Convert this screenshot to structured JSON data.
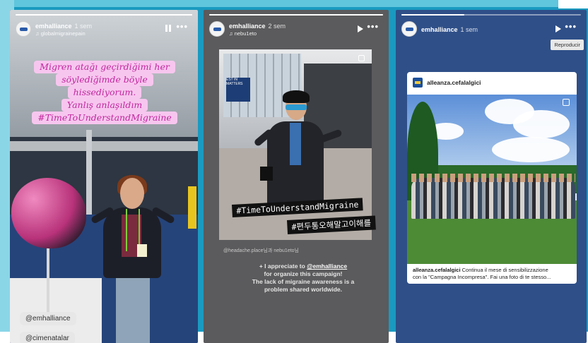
{
  "stories": [
    {
      "username": "emhalliance",
      "time": "1 sem",
      "subline": "globalmigrainepain",
      "progress": 1.0,
      "control": "pause",
      "more_label": "•••",
      "caption_lines": [
        "Migren atağı geçirdiğimi her",
        "söylediğimde böyle",
        "hissediyorum.",
        "Yanlış anlaşıldım",
        "#TimeToUnderstandMigraine"
      ],
      "mention_tags": [
        "@emhalliance",
        "@cimenatalar"
      ]
    },
    {
      "username": "emhalliance",
      "time": "2 sem",
      "subline": "nebu1eto",
      "progress": 1.0,
      "control": "play",
      "more_label": "•••",
      "sign_text": "EST IN MATTERS",
      "hashtags": [
        "#TimeToUnderstandMigraine",
        "#편두통오해말고이해를"
      ],
      "mention_line": "@headache.place님과 nebu1eto님",
      "post_text": {
        "line1_prefix": "+ I appreciate to ",
        "line1_mention": "@emhalliance",
        "lines": [
          "for organize this campaign!",
          "The lack of migraine awareness is a",
          "problem shared worldwide."
        ]
      }
    },
    {
      "username": "emhalliance",
      "time": "1 sem",
      "progress": 0.35,
      "control": "play",
      "more_label": "•••",
      "tooltip": "Reproducir",
      "card": {
        "username": "alleanza.cefalalgici",
        "caption_user": "alleanza.cefalalgici",
        "caption_line1": " Continua il mese di sensibilizzazione",
        "caption_line2": "con la \"Campagna Incompresa\". Fai una foto di te stesso..."
      }
    }
  ],
  "colors": {
    "background": "#1a9ac0",
    "caption_bg": "#f7c6ef",
    "caption_text": "#c0289d"
  }
}
